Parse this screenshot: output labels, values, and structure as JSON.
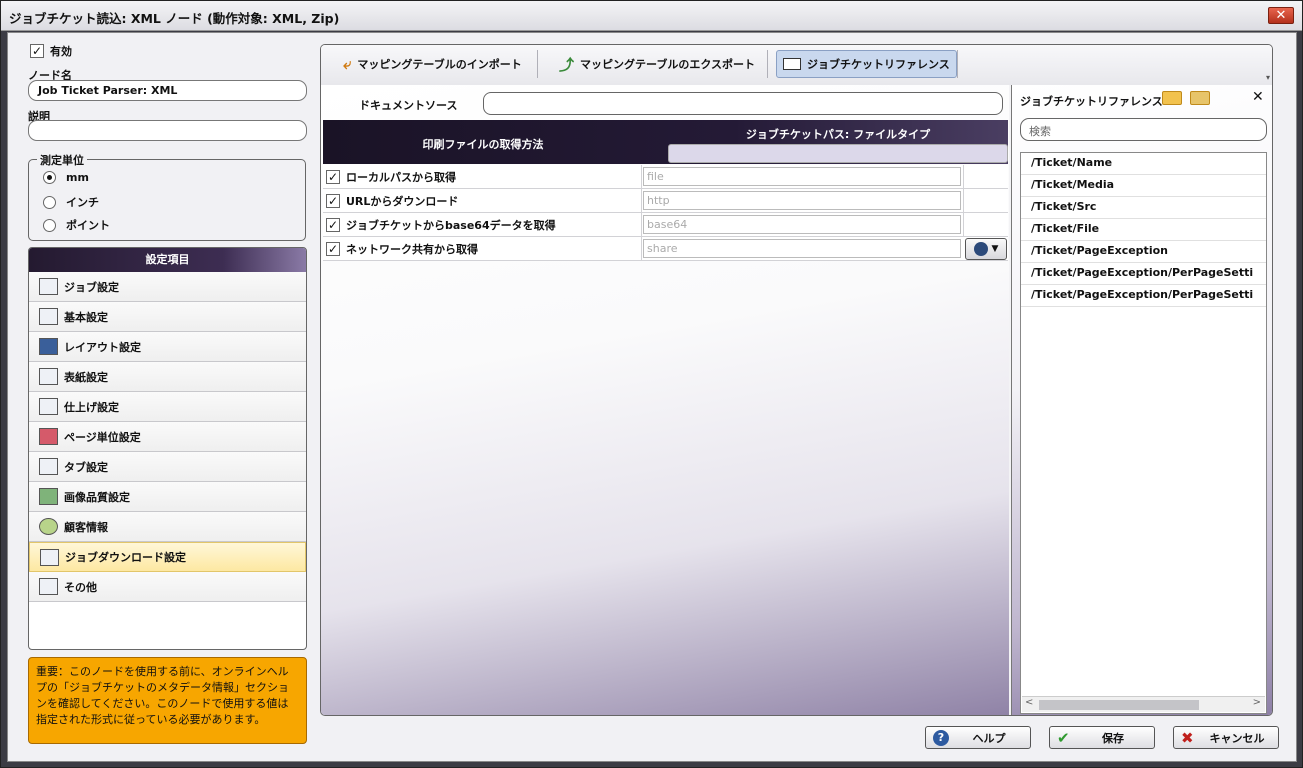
{
  "window": {
    "title": "ジョブチケット読込: XML ノード (動作対象: XML, Zip)",
    "close": "✕"
  },
  "left": {
    "enabled_label": "有効",
    "enabled": true,
    "node_name_label": "ノード名",
    "node_name_value": "Job Ticket Parser: XML",
    "description_label": "説明",
    "description_value": "",
    "units": {
      "legend": "測定単位",
      "options": [
        "mm",
        "インチ",
        "ポイント"
      ],
      "selected": "mm"
    },
    "settings": {
      "header": "設定項目",
      "items": [
        "ジョブ設定",
        "基本設定",
        "レイアウト設定",
        "表紙設定",
        "仕上げ設定",
        "ページ単位設定",
        "タブ設定",
        "画像品質設定",
        "顧客情報",
        "ジョブダウンロード設定",
        "その他"
      ],
      "selected": "ジョブダウンロード設定"
    },
    "notice": "重要：このノードを使用する前に、オンラインヘルプの「ジョブチケットのメタデータ情報」セクションを確認してください。このノードで使用する値は指定された形式に従っている必要があります。"
  },
  "toolbar": {
    "import": "マッピングテーブルのインポート",
    "export": "マッピングテーブルのエクスポート",
    "reference": "ジョブチケットリファレンス"
  },
  "main": {
    "doc_source_label": "ドキュメントソース",
    "doc_source_value": "",
    "col_method": "印刷ファイルの取得方法",
    "col_path": "ジョブチケットパス: ファイルタイプ",
    "rows": [
      {
        "label": "ローカルパスから取得",
        "value": "file",
        "checked": true
      },
      {
        "label": "URLからダウンロード",
        "value": "http",
        "checked": true
      },
      {
        "label": "ジョブチケットからbase64データを取得",
        "value": "base64",
        "checked": true
      },
      {
        "label": "ネットワーク共有から取得",
        "value": "share",
        "checked": true
      }
    ]
  },
  "reference_panel": {
    "title": "ジョブチケットリファレンス",
    "search_placeholder": "検索",
    "items": [
      "/Ticket/Name",
      "/Ticket/Media",
      "/Ticket/Src",
      "/Ticket/File",
      "/Ticket/PageException",
      "/Ticket/PageException/PerPageSetti",
      "/Ticket/PageException/PerPageSetti"
    ]
  },
  "buttons": {
    "help": "ヘルプ",
    "save": "保存",
    "cancel": "キャンセル"
  }
}
